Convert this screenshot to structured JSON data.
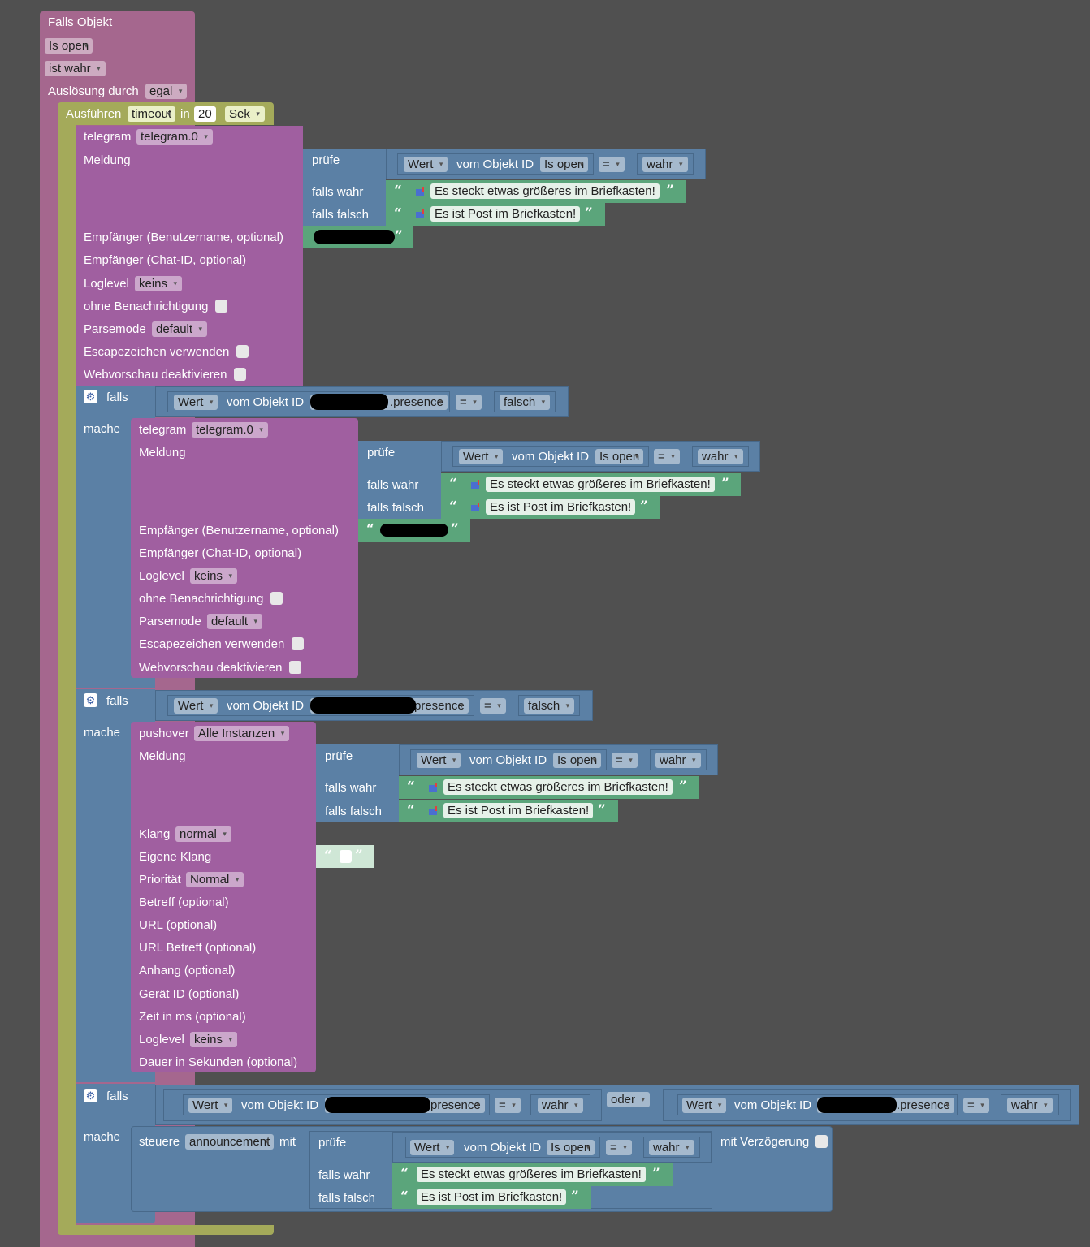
{
  "root": {
    "falls_objekt": "Falls Objekt",
    "object": "Is open",
    "condition": "ist wahr",
    "trigger_label": "Auslösung durch",
    "trigger_value": "egal"
  },
  "timeout": {
    "label": "Ausführen",
    "type": "timeout",
    "in": "in",
    "value": "20",
    "unit": "Sek"
  },
  "labels": {
    "telegram": "telegram",
    "telegram_instance": "telegram.0",
    "meldung": "Meldung",
    "pruefe": "prüfe",
    "falls_wahr": "falls wahr",
    "falls_falsch": "falls falsch",
    "empf_user": "Empfänger (Benutzername, optional)",
    "empf_chat": "Empfänger (Chat-ID, optional)",
    "loglevel": "Loglevel",
    "loglevel_value": "keins",
    "ohne_benachrichtigung": "ohne Benachrichtigung",
    "parsemode": "Parsemode",
    "parsemode_value": "default",
    "escape": "Escapezeichen verwenden",
    "webvorschau": "Webvorschau deaktivieren",
    "falls": "falls",
    "mache": "mache",
    "wert": "Wert",
    "vom_objekt_id": "vom Objekt ID",
    "is_open": "Is open",
    "eq": "=",
    "wahr": "wahr",
    "falsch": "falsch",
    "msg_big": "Es steckt etwas größeres im Briefkasten!",
    "msg_post": "Es ist Post im Briefkasten!",
    "presence": ".presence",
    "presence2": "presence",
    "oder": "oder"
  },
  "pushover": {
    "label": "pushover",
    "instance": "Alle Instanzen",
    "klang": "Klang",
    "klang_value": "normal",
    "eigene_klang": "Eigene Klang",
    "prioritaet": "Priorität",
    "prioritaet_value": "Normal",
    "betreff": "Betreff (optional)",
    "url": "URL (optional)",
    "url_betreff": "URL Betreff (optional)",
    "anhang": "Anhang (optional)",
    "geraet": "Gerät ID (optional)",
    "zeit": "Zeit in ms (optional)",
    "dauer": "Dauer in Sekunden (optional)"
  },
  "steuere": {
    "label": "steuere",
    "target": "announcement",
    "mit": "mit",
    "mit_verzoegerung": "mit Verzögerung"
  }
}
